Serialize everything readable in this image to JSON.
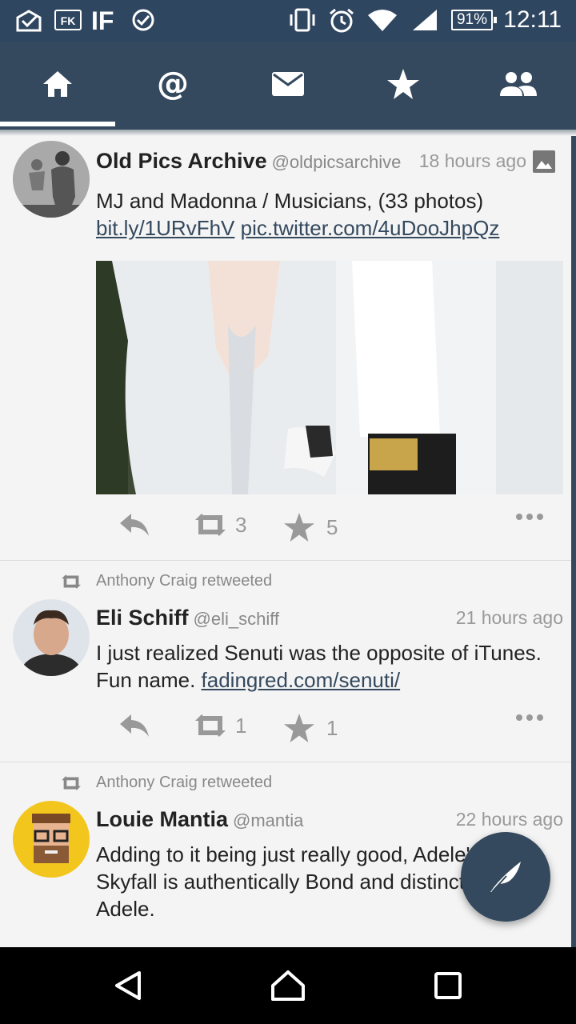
{
  "status_bar": {
    "battery": "91%",
    "time": "12:11",
    "left_icons": [
      "mail-check-icon",
      "fk-app-icon",
      "if-app-icon",
      "signal-badge-icon"
    ],
    "right_icons": [
      "vibrate-icon",
      "alarm-icon",
      "wifi-icon",
      "cell-signal-icon",
      "battery-icon"
    ]
  },
  "tabs": [
    {
      "icon": "home-icon",
      "active": true
    },
    {
      "icon": "mentions-icon",
      "label": "@"
    },
    {
      "icon": "messages-icon"
    },
    {
      "icon": "favorites-icon"
    },
    {
      "icon": "people-icon"
    }
  ],
  "tweets": [
    {
      "name": "Old Pics Archive",
      "handle": "@oldpicsarchive",
      "time": "18 hours ago",
      "text": "MJ and Madonna / Musicians, (33 photos)",
      "link1": "bit.ly/1URvFhV",
      "link2": "pic.twitter.com/4uDooJhpQz",
      "retweets": "3",
      "favorites": "5",
      "has_media": true
    },
    {
      "retweeted_by": "Anthony Craig retweeted",
      "name": "Eli Schiff",
      "handle": "@eli_schiff",
      "time": "21 hours ago",
      "text": "I just realized Senuti was the opposite of iTunes. Fun name.",
      "link1": "fadingred.com/senuti/",
      "retweets": "1",
      "favorites": "1"
    },
    {
      "retweeted_by": "Anthony Craig retweeted",
      "name": "Louie Mantia",
      "handle": "@mantia",
      "time": "22 hours ago",
      "text_lines": [
        "Adding to it being just really good, Adele's",
        "Skyfall is authentically Bond and distinctly",
        "Adele."
      ]
    }
  ],
  "colors": {
    "primary": "#34495e",
    "status_bar": "#2f4661",
    "background": "#f4f4f4"
  }
}
